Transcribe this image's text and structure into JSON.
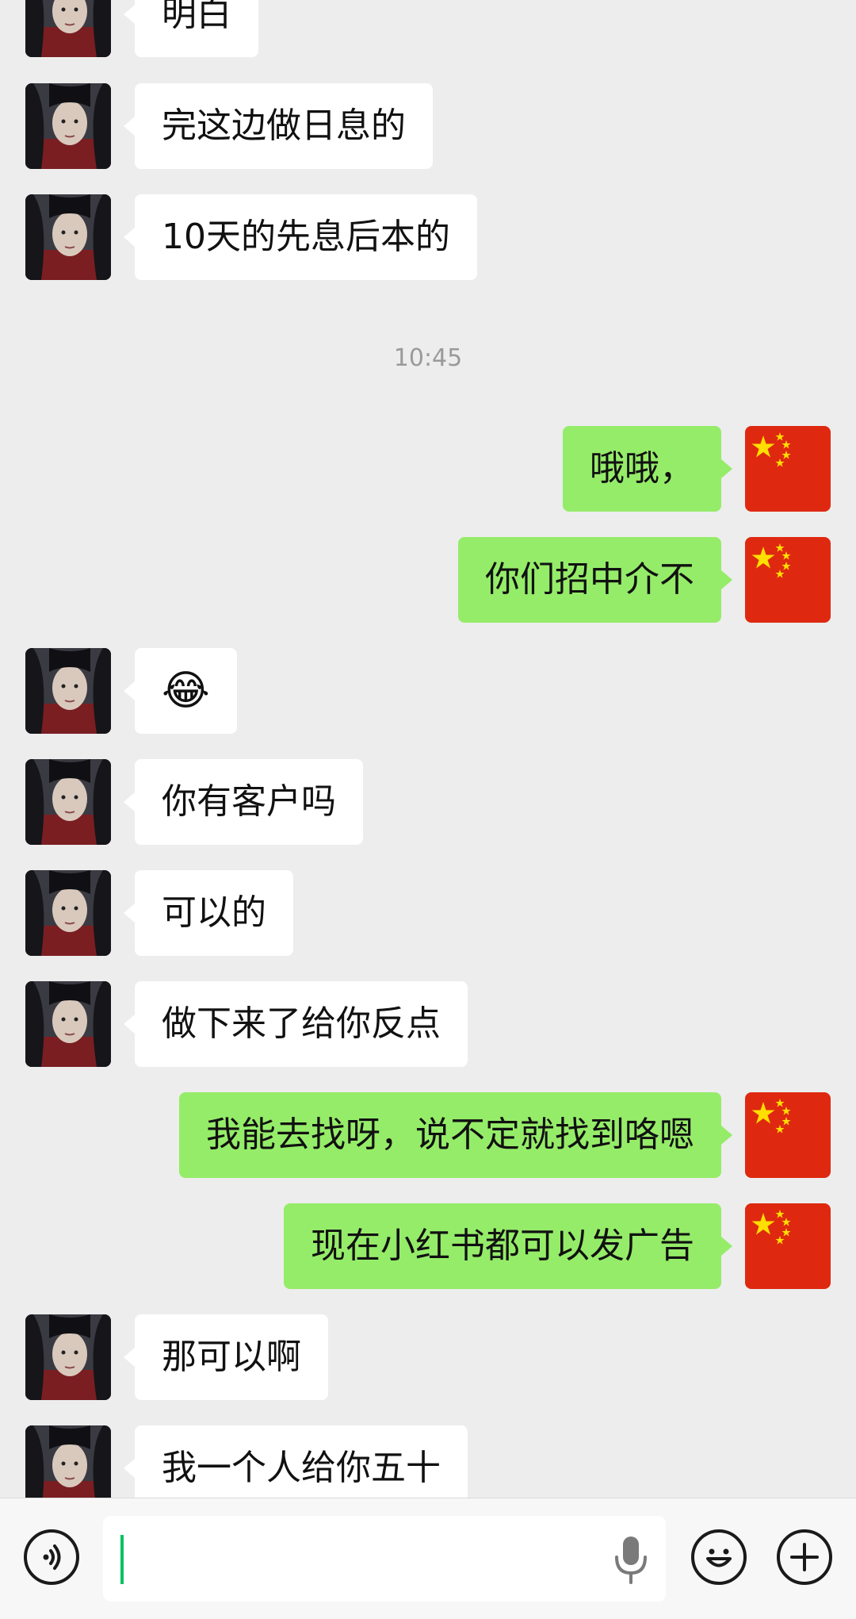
{
  "timestamp": "10:45",
  "messages": [
    {
      "side": "in",
      "text": "明白"
    },
    {
      "side": "in",
      "text": "完这边做日息的"
    },
    {
      "side": "in",
      "text": "10天的先息后本的"
    },
    {
      "side": "out",
      "text": "哦哦，"
    },
    {
      "side": "out",
      "text": "你们招中介不"
    },
    {
      "side": "in",
      "text": "😂"
    },
    {
      "side": "in",
      "text": "你有客户吗"
    },
    {
      "side": "in",
      "text": "可以的"
    },
    {
      "side": "in",
      "text": "做下来了给你反点"
    },
    {
      "side": "out",
      "text": "我能去找呀，说不定就找到咯嗯"
    },
    {
      "side": "out",
      "text": "现在小红书都可以发广告"
    },
    {
      "side": "in",
      "text": "那可以啊"
    },
    {
      "side": "in",
      "text": "我一个人给你五十"
    }
  ],
  "input": {
    "value": "",
    "placeholder": ""
  },
  "icons": {
    "voice": "voice-icon",
    "mic": "microphone-icon",
    "emoji": "emoji-icon",
    "plus": "plus-icon",
    "contact_avatar": "contact-avatar",
    "self_avatar": "china-flag-avatar"
  },
  "colors": {
    "background": "#EDEDED",
    "incoming_bubble": "#FFFFFF",
    "outgoing_bubble": "#95EC69",
    "caret": "#07C160"
  }
}
